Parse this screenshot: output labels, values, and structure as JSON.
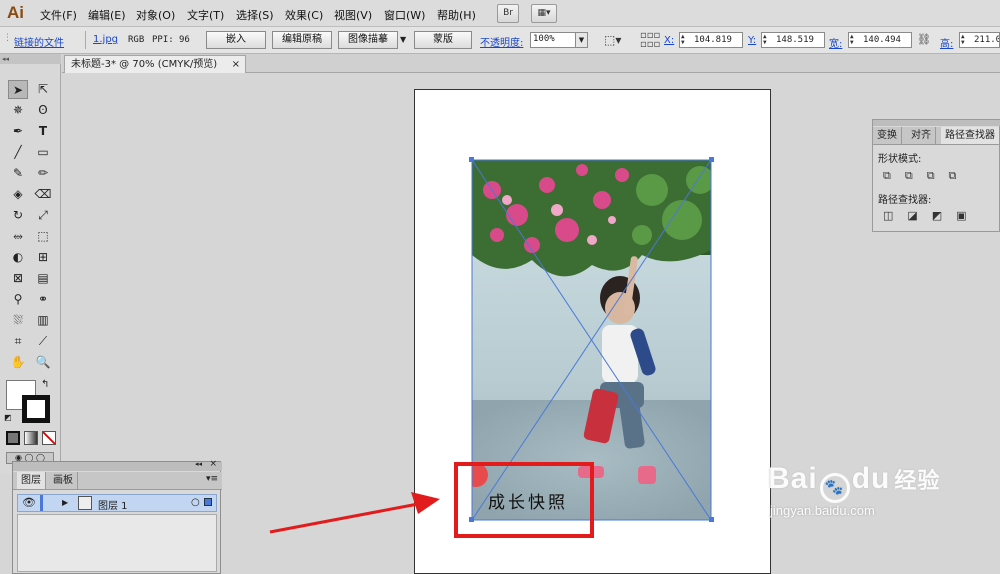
{
  "app": {
    "logo": "Ai",
    "accent": "#8a4a10"
  },
  "menu": {
    "items": [
      "文件(F)",
      "编辑(E)",
      "对象(O)",
      "文字(T)",
      "选择(S)",
      "效果(C)",
      "视图(V)",
      "窗口(W)",
      "帮助(H)"
    ],
    "bridge_button": "Br"
  },
  "control_bar": {
    "linked_file_label": "链接的文件",
    "file_name": "1.jpg",
    "color_mode": "RGB",
    "ppi_label": "PPI:",
    "ppi_value": "96",
    "embed_button": "嵌入",
    "edit_original_button": "编辑原稿",
    "image_trace_button": "图像描摹",
    "mask_button": "蒙版",
    "opacity_label": "不透明度:",
    "opacity_value": "100%",
    "x_label": "X:",
    "x_value": "104.819",
    "y_label": "Y:",
    "y_value": "148.519",
    "w_label": "宽:",
    "w_value": "140.494",
    "h_label": "高:",
    "h_value": "211.0"
  },
  "document_tab": {
    "title": "未标题-3* @ 70% (CMYK/预览)",
    "close": "×"
  },
  "artboard": {
    "caption": "成长快照"
  },
  "pathfinder_panel": {
    "tabs": [
      "变换",
      "对齐",
      "路径查找器"
    ],
    "shape_modes_label": "形状模式:",
    "pathfinders_label": "路径查找器:"
  },
  "layers_panel": {
    "tabs": [
      "图层",
      "画板"
    ],
    "collapse": "◂◂",
    "close": "×",
    "layer_name": "图层 1"
  },
  "watermark": {
    "brand": "Bai",
    "brand2": "du",
    "product": "经验",
    "url": "jingyan.baidu.com"
  },
  "colors": {
    "annotation_red": "#e21c1c",
    "selection_blue": "#4a78d8"
  }
}
